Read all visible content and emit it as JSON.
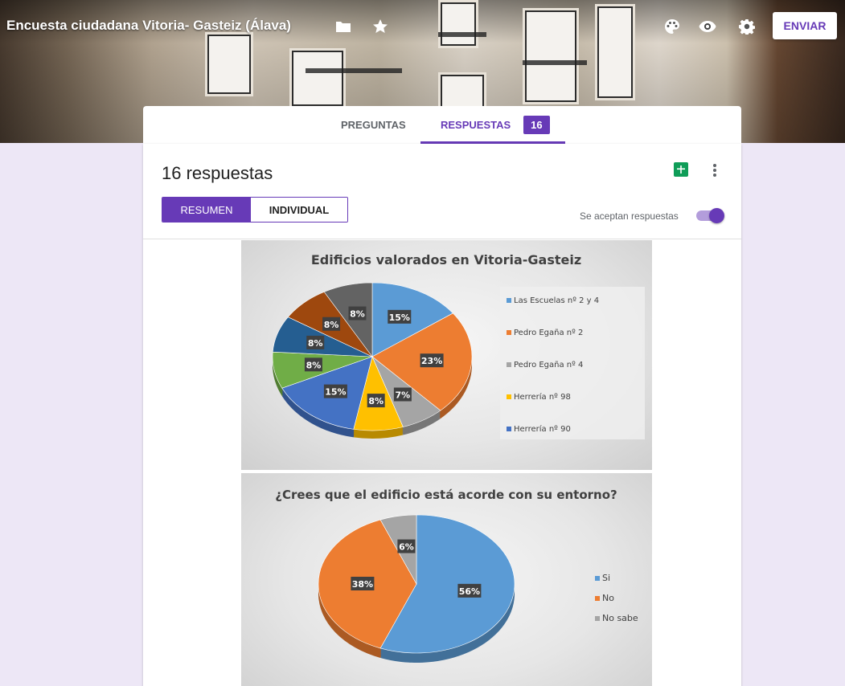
{
  "header": {
    "title": "Encuesta ciudadana Vitoria- Gasteiz (Álava)",
    "icons": [
      "folder-icon",
      "star-icon",
      "palette-icon",
      "eye-icon",
      "gear-icon"
    ],
    "send_label": "ENVIAR"
  },
  "tabs": {
    "questions": "PREGUNTAS",
    "responses": "RESPUESTAS",
    "responses_count": "16"
  },
  "responses": {
    "title": "16 respuestas",
    "summary_label": "RESUMEN",
    "individual_label": "INDIVIDUAL",
    "accepting_label": "Se aceptan respuestas",
    "accepting": true
  },
  "colors": {
    "accent": "#673ab7",
    "background": "#ede7f6",
    "sheets_green": "#0f9d58"
  },
  "chart_data": [
    {
      "type": "pie",
      "title": "Edificios valorados en Vitoria-Gasteiz",
      "slices": [
        {
          "label": "Las Escuelas nº 2 y 4",
          "value": 15,
          "color": "#5b9bd5"
        },
        {
          "label": "Pedro Egaña nº 2",
          "value": 23,
          "color": "#ed7d31"
        },
        {
          "label": "Pedro Egaña nº 4",
          "value": 7,
          "color": "#a5a5a5"
        },
        {
          "label": "Herrería nº 98",
          "value": 8,
          "color": "#ffc000"
        },
        {
          "label": "Herrería nº 90",
          "value": 15,
          "color": "#4472c4"
        },
        {
          "label": "",
          "value": 8,
          "color": "#70ad47"
        },
        {
          "label": "",
          "value": 8,
          "color": "#255e91"
        },
        {
          "label": "",
          "value": 8,
          "color": "#9e480e"
        },
        {
          "label": "",
          "value": 8,
          "color": "#636363"
        }
      ],
      "data_labels": [
        "15%",
        "23%",
        "7%",
        "8%",
        "15%",
        "8%",
        "8%",
        "8%",
        "8%"
      ],
      "legend": [
        "Las Escuelas nº 2 y 4",
        "Pedro Egaña nº 2",
        "Pedro Egaña nº 4",
        "Herrería nº 98",
        "Herrería nº 90"
      ],
      "legend_position": "right"
    },
    {
      "type": "pie",
      "title": "¿Crees que el edificio está acorde con su entorno?",
      "slices": [
        {
          "label": "Si",
          "value": 56,
          "color": "#5b9bd5"
        },
        {
          "label": "No",
          "value": 38,
          "color": "#ed7d31"
        },
        {
          "label": "No sabe",
          "value": 6,
          "color": "#a5a5a5"
        }
      ],
      "data_labels": [
        "56%",
        "38%",
        "6%"
      ],
      "legend": [
        "Si",
        "No",
        "No sabe"
      ],
      "legend_position": "right"
    }
  ]
}
